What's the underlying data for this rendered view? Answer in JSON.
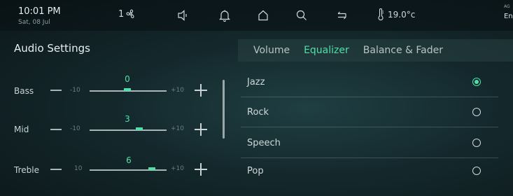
{
  "status": {
    "time": "10:01 PM",
    "date": "Sat, 08 Jul",
    "fan_level": "1",
    "temperature": "19.0°c",
    "right_small": "AG",
    "right_label": "En"
  },
  "icons": {
    "fan": "fan-icon",
    "speaker": "speaker-icon",
    "bell": "bell-icon",
    "home": "home-icon",
    "search": "search-icon",
    "back": "return-icon",
    "thermometer": "thermometer-icon"
  },
  "colors": {
    "accent": "#4fe0a8",
    "background": "#14282c"
  },
  "page": {
    "title": "Audio Settings"
  },
  "tabs": [
    {
      "label": "Volume",
      "active": false
    },
    {
      "label": "Equalizer",
      "active": true
    },
    {
      "label": "Balance & Fader",
      "active": false
    }
  ],
  "equalizer": {
    "min_label": "-10",
    "max_label": "+10",
    "bands": [
      {
        "name": "Bass",
        "value": "0",
        "min_label": "-10"
      },
      {
        "name": "Mid",
        "value": "3",
        "min_label": "-10"
      },
      {
        "name": "Treble",
        "value": "6",
        "min_label": "10"
      }
    ]
  },
  "presets": [
    {
      "label": "Jazz",
      "selected": true
    },
    {
      "label": "Rock",
      "selected": false
    },
    {
      "label": "Speech",
      "selected": false
    },
    {
      "label": "Pop",
      "selected": false
    }
  ]
}
